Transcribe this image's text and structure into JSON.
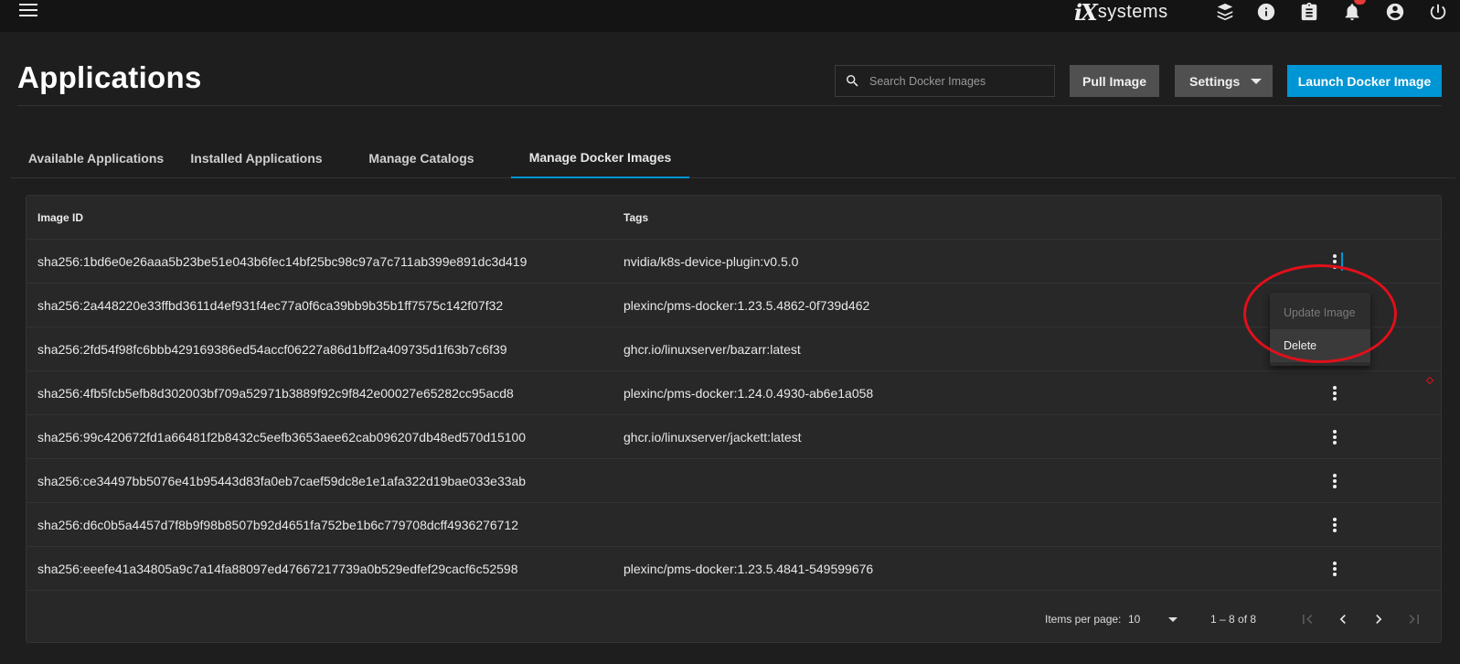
{
  "topbar": {
    "logo_mark": "iX",
    "logo_text": "systems",
    "icons": [
      "menu-icon",
      "truecommand-icon",
      "info-icon",
      "clipboard-icon",
      "bell-icon",
      "account-icon",
      "power-icon"
    ]
  },
  "header": {
    "title": "Applications",
    "search_placeholder": "Search Docker Images",
    "pull_label": "Pull Image",
    "settings_label": "Settings",
    "launch_label": "Launch Docker Image"
  },
  "tabs": [
    {
      "label": "Available Applications",
      "active": false
    },
    {
      "label": "Installed Applications",
      "active": false
    },
    {
      "label": "Manage Catalogs",
      "active": false
    },
    {
      "label": "Manage Docker Images",
      "active": true
    }
  ],
  "table": {
    "columns": [
      "Image ID",
      "Tags"
    ],
    "rows": [
      {
        "id": "sha256:1bd6e0e26aaa5b23be51e043b6fec14bf25bc98c97a7c711ab399e891dc3d419",
        "tags": "nvidia/k8s-device-plugin:v0.5.0"
      },
      {
        "id": "sha256:2a448220e33ffbd3611d4ef931f4ec77a0f6ca39bb9b35b1ff7575c142f07f32",
        "tags": "plexinc/pms-docker:1.23.5.4862-0f739d462"
      },
      {
        "id": "sha256:2fd54f98fc6bbb429169386ed54accf06227a86d1bff2a409735d1f63b7c6f39",
        "tags": "ghcr.io/linuxserver/bazarr:latest"
      },
      {
        "id": "sha256:4fb5fcb5efb8d302003bf709a52971b3889f92c9f842e00027e65282cc95acd8",
        "tags": "plexinc/pms-docker:1.24.0.4930-ab6e1a058"
      },
      {
        "id": "sha256:99c420672fd1a66481f2b8432c5eefb3653aee62cab096207db48ed570d15100",
        "tags": "ghcr.io/linuxserver/jackett:latest"
      },
      {
        "id": "sha256:ce34497bb5076e41b95443d83fa0eb7caef59dc8e1e1afa322d19bae033e33ab",
        "tags": ""
      },
      {
        "id": "sha256:d6c0b5a4457d7f8b9f98b8507b92d4651fa752be1b6c779708dcff4936276712",
        "tags": ""
      },
      {
        "id": "sha256:eeefe41a34805a9c7a14fa88097ed47667217739a0b529edfef29cacf6c52598",
        "tags": "plexinc/pms-docker:1.23.5.4841-549599676"
      }
    ]
  },
  "context_menu": {
    "update_label": "Update Image",
    "delete_label": "Delete"
  },
  "paginator": {
    "items_per_page_label": "Items per page:",
    "items_per_page_value": "10",
    "range_label": "1 – 8 of 8"
  },
  "colors": {
    "accent": "#0095d5",
    "annotation": "#e0101a",
    "badge": "#e53935"
  }
}
